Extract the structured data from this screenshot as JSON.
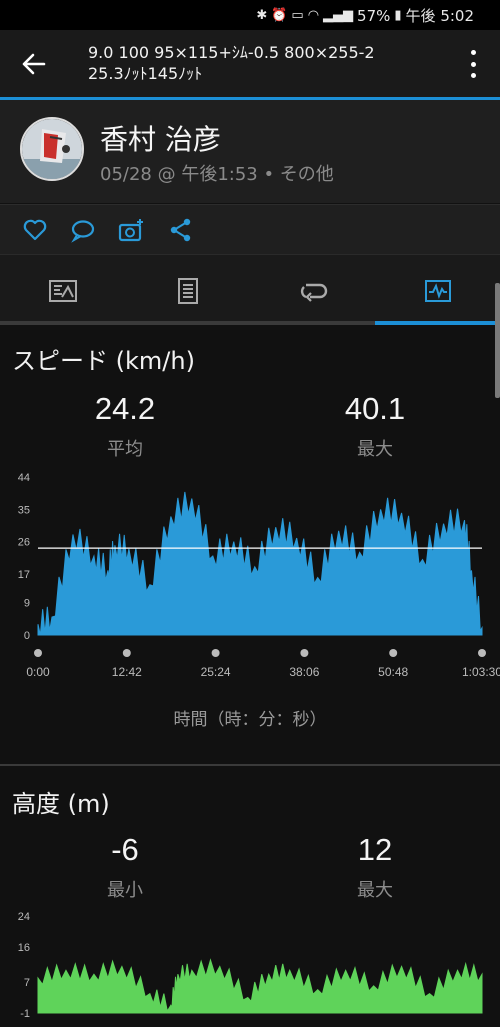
{
  "status_bar": {
    "battery": "57%",
    "time": "午後 5:02"
  },
  "header": {
    "title_line1": "9.0 100 95×115+ｼﾑ-0.5 800×255-2",
    "title_line2": "25.3ﾉｯﾄ145ﾉｯﾄ"
  },
  "profile": {
    "name": "香村 治彦",
    "subline": "05/28 @ 午後1:53 • その他"
  },
  "tabs": [
    {
      "name": "summary-tab-icon"
    },
    {
      "name": "details-tab-icon"
    },
    {
      "name": "laps-tab-icon"
    },
    {
      "name": "charts-tab-icon",
      "active": true
    }
  ],
  "speed": {
    "title": "スピード (km/h)",
    "avg_value": "24.2",
    "avg_label": "平均",
    "max_value": "40.1",
    "max_label": "最大",
    "x_axis_label": "時間（時：分：秒）"
  },
  "altitude": {
    "title": "高度 (m)",
    "min_value": "-6",
    "min_label": "最小",
    "max_value": "12",
    "max_label": "最大"
  },
  "chart_data": [
    {
      "type": "area",
      "color": "#2a9ad8",
      "ylim": [
        0,
        44
      ],
      "y_ticks": [
        "44",
        "35",
        "26",
        "17",
        "9",
        "0"
      ],
      "x_ticks": [
        "0:00",
        "12:42",
        "25:24",
        "38:06",
        "50:48",
        "1:03:30"
      ],
      "reference_line": 24.2,
      "x": [
        0,
        2,
        5,
        8,
        10,
        11,
        13,
        16,
        19,
        22,
        25,
        28,
        31,
        34,
        37,
        40,
        43,
        46,
        49,
        52,
        55,
        58,
        61,
        62,
        63.5
      ],
      "values": [
        3,
        5,
        28,
        22,
        18,
        25,
        24,
        14,
        33,
        38,
        22,
        26,
        19,
        30,
        27,
        16,
        29,
        23,
        35,
        34,
        21,
        31,
        32,
        18,
        2
      ]
    },
    {
      "type": "area",
      "color": "#5fd35a",
      "ylim": [
        -1,
        24
      ],
      "y_ticks": [
        "24",
        "16",
        "7",
        "-1"
      ],
      "x": [
        0,
        4,
        8,
        12,
        16,
        19,
        20,
        22,
        26,
        30,
        33,
        36,
        40,
        44,
        48,
        52,
        56,
        60,
        63.5
      ],
      "values": [
        8,
        10,
        9,
        11,
        4,
        1,
        9,
        10,
        11,
        3,
        9,
        10,
        5,
        10,
        6,
        11,
        4,
        10,
        9
      ]
    }
  ]
}
